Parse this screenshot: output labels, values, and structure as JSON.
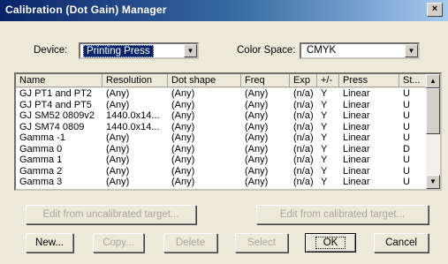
{
  "window": {
    "title": "Calibration (Dot Gain) Manager",
    "close_glyph": "×"
  },
  "device": {
    "label": "Device:",
    "value": "Printing Press"
  },
  "color_space": {
    "label": "Color Space:",
    "value": "CMYK"
  },
  "table": {
    "columns": [
      "Name",
      "Resolution",
      "Dot shape",
      "Freq",
      "Exp",
      "+/-",
      "Press",
      "St..."
    ],
    "rows": [
      [
        "GJ PT1 and PT2",
        "(Any)",
        "(Any)",
        "(Any)",
        "(n/a)",
        "Y",
        "Linear",
        "U"
      ],
      [
        "GJ PT4 and PT5",
        "(Any)",
        "(Any)",
        "(Any)",
        "(n/a)",
        "Y",
        "Linear",
        "U"
      ],
      [
        "GJ SM52 0809v2",
        "1440.0x14...",
        "(Any)",
        "(Any)",
        "(n/a)",
        "Y",
        "Linear",
        "U"
      ],
      [
        "GJ SM74 0809",
        "1440.0x14...",
        "(Any)",
        "(Any)",
        "(n/a)",
        "Y",
        "Linear",
        "U"
      ],
      [
        "Gamma -1",
        "(Any)",
        "(Any)",
        "(Any)",
        "(n/a)",
        "Y",
        "Linear",
        "U"
      ],
      [
        "Gamma 0",
        "(Any)",
        "(Any)",
        "(Any)",
        "(n/a)",
        "Y",
        "Linear",
        "D"
      ],
      [
        "Gamma 1",
        "(Any)",
        "(Any)",
        "(Any)",
        "(n/a)",
        "Y",
        "Linear",
        "U"
      ],
      [
        "Gamma 2",
        "(Any)",
        "(Any)",
        "(Any)",
        "(n/a)",
        "Y",
        "Linear",
        "U"
      ],
      [
        "Gamma 3",
        "(Any)",
        "(Any)",
        "(Any)",
        "(n/a)",
        "Y",
        "Linear",
        "U"
      ]
    ]
  },
  "buttons": {
    "edit_uncalibrated": "Edit from uncalibrated target...",
    "edit_calibrated": "Edit from calibrated target...",
    "new": "New...",
    "copy": "Copy...",
    "delete": "Delete",
    "select": "Select",
    "ok": "OK",
    "cancel": "Cancel"
  },
  "icons": {
    "dropdown": "chevron-down-icon",
    "scroll_up": "arrow-up-icon",
    "scroll_down": "arrow-down-icon"
  },
  "colors": {
    "title_start": "#0a246a",
    "title_end": "#a6caf0",
    "selection": "#0a246a",
    "dialog_bg": "#ece9d8"
  }
}
